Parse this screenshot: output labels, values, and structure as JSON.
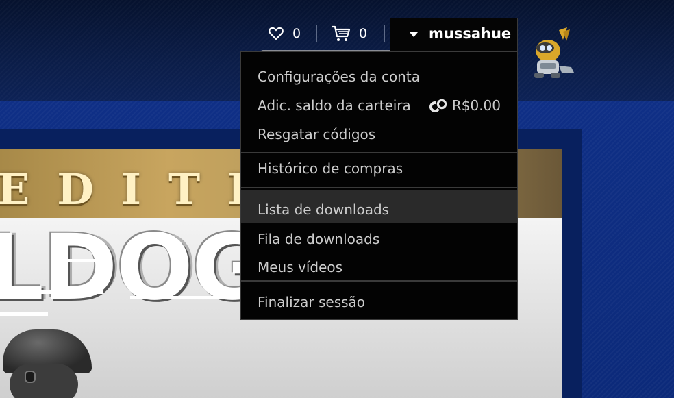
{
  "header": {
    "wishlist_count": "0",
    "cart_count": "0",
    "username": "mussahue"
  },
  "account_menu": {
    "items": [
      {
        "label": "Configurações da conta"
      },
      {
        "label": "Adic. saldo da carteira",
        "wallet_balance": "R$0.00"
      },
      {
        "label": "Resgatar códigos"
      },
      {
        "label": "Histórico de compras"
      },
      {
        "label": "Lista de downloads"
      },
      {
        "label": "Fila de downloads"
      },
      {
        "label": "Meus vídeos"
      },
      {
        "label": "Finalizar sessão"
      }
    ],
    "highlighted_index": 4
  },
  "hero": {
    "edition_text": "EDITI",
    "title_text": "LDOG"
  },
  "colors": {
    "page_background": "#0a1c4a",
    "menu_background": "#030303",
    "menu_highlight": "#2a2a2a",
    "menu_text": "#cccccc",
    "gold_band": "#c8a55f"
  },
  "icons": {
    "wishlist": "heart-icon",
    "cart": "cart-icon",
    "dropdown": "caret-down-icon",
    "wallet": "coin-icon"
  }
}
